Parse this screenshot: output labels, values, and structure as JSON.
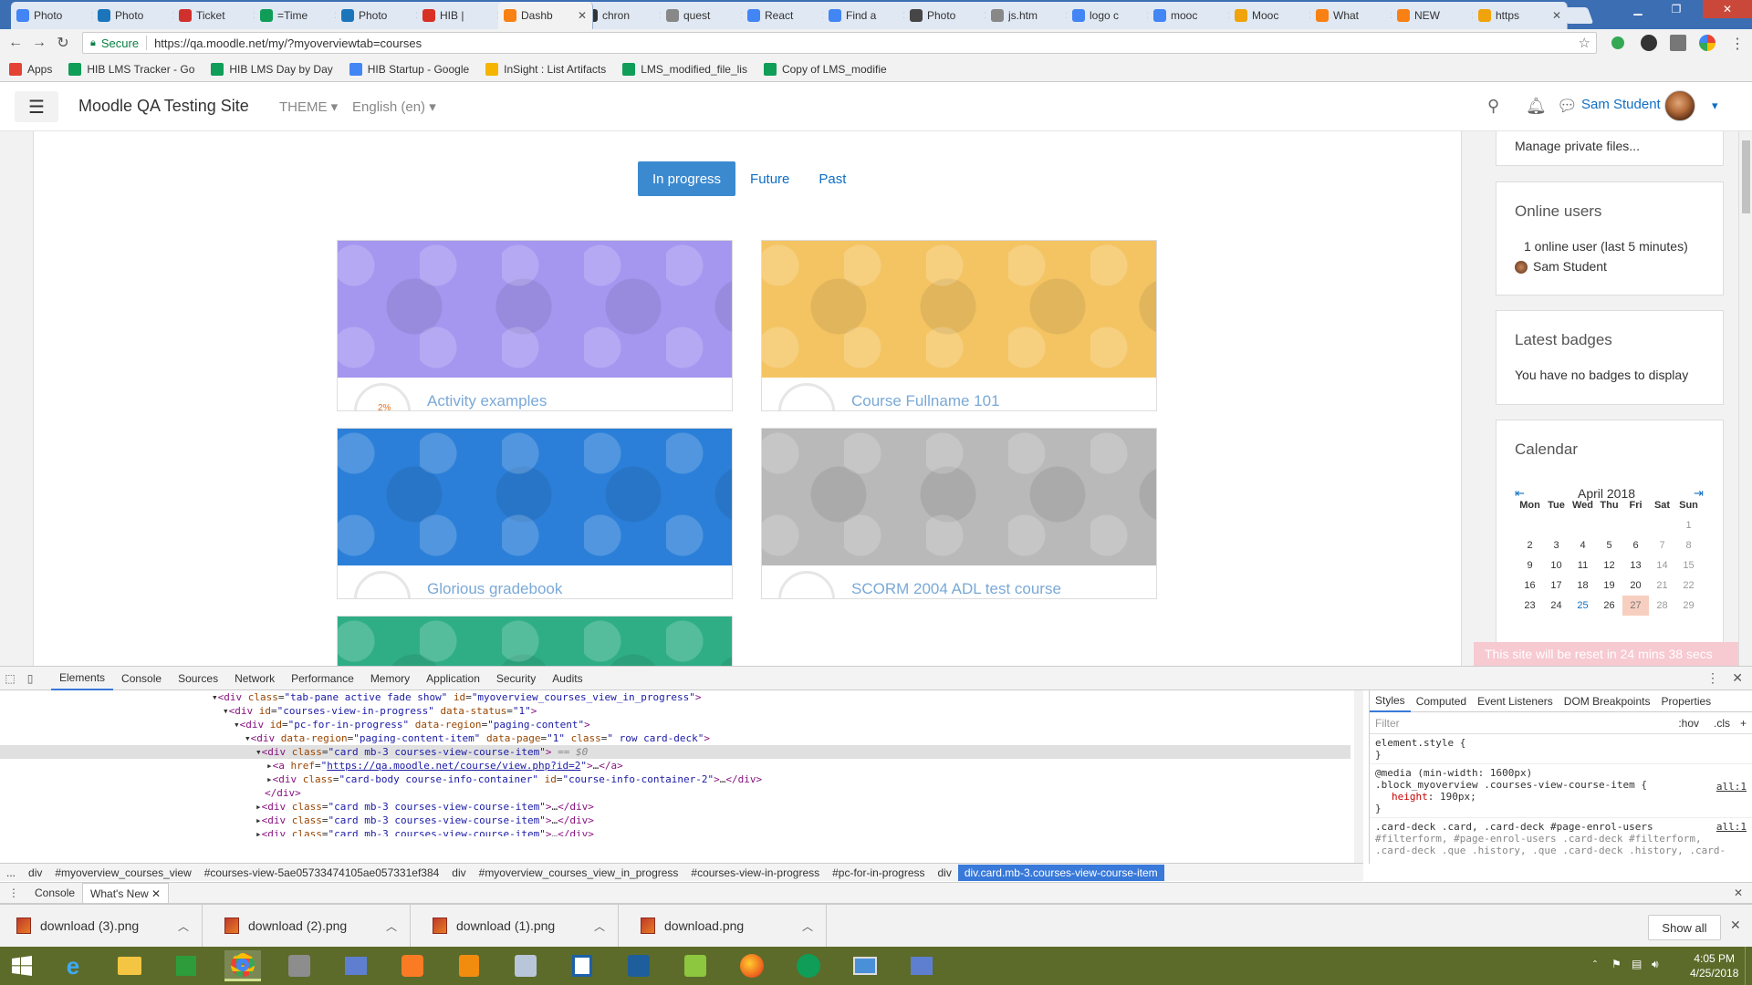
{
  "browser": {
    "tabs": [
      {
        "title": "Photo",
        "fav": "#4285f4",
        "fav_icon": "chrome-photos-icon"
      },
      {
        "title": "Photo",
        "fav": "#1b75bb",
        "fav_icon": "diamond-icon"
      },
      {
        "title": "Ticket",
        "fav": "#d0312d",
        "fav_icon": "ticket-icon"
      },
      {
        "title": "=Time",
        "fav": "#0f9d58",
        "fav_icon": "sheets-icon"
      },
      {
        "title": "Photo",
        "fav": "#1b75bb",
        "fav_icon": "diamond-icon"
      },
      {
        "title": "HIB |",
        "fav": "#d93025",
        "fav_icon": "gmail-icon"
      },
      {
        "title": "Dashb",
        "fav": "#f98012",
        "fav_icon": "moodle-icon"
      },
      {
        "title": "chron",
        "fav": "#333333",
        "fav_icon": "github-icon"
      },
      {
        "title": "quest",
        "fav": "#888888",
        "fav_icon": "doc-icon"
      },
      {
        "title": "React",
        "fav": "#4285f4",
        "fav_icon": "docs-icon"
      },
      {
        "title": "Find a",
        "fav": "#4285f4",
        "fav_icon": "google-icon"
      },
      {
        "title": "Photo",
        "fav": "#464646",
        "fav_icon": "wordpress-icon"
      },
      {
        "title": "js.htm",
        "fav": "#888888",
        "fav_icon": "doc-icon"
      },
      {
        "title": "logo c",
        "fav": "#4285f4",
        "fav_icon": "google-icon"
      },
      {
        "title": "mooc",
        "fav": "#4285f4",
        "fav_icon": "google-icon"
      },
      {
        "title": "Mooc",
        "fav": "#f0a30a",
        "fav_icon": "chart-icon"
      },
      {
        "title": "What",
        "fav": "#f98012",
        "fav_icon": "moodle-icon"
      },
      {
        "title": "NEW",
        "fav": "#f98012",
        "fav_icon": "moodle-icon"
      },
      {
        "title": "https",
        "fav": "#f0a30a",
        "fav_icon": "chart-icon"
      }
    ],
    "secure_label": "Secure",
    "url": "https://qa.moodle.net/my/?myoverviewtab=courses",
    "bookmarks": [
      {
        "label": "Apps",
        "color": "#e34234"
      },
      {
        "label": "HIB LMS Tracker - Go",
        "color": "#0f9d58"
      },
      {
        "label": "HIB LMS Day by Day",
        "color": "#0f9d58"
      },
      {
        "label": "HIB Startup - Google",
        "color": "#4285f4"
      },
      {
        "label": "InSight : List Artifacts",
        "color": "#f5b400"
      },
      {
        "label": "LMS_modified_file_lis",
        "color": "#0f9d58"
      },
      {
        "label": "Copy of LMS_modifie",
        "color": "#0f9d58"
      }
    ]
  },
  "navbar": {
    "site_name": "Moodle QA Testing Site",
    "theme_label": "THEME",
    "language_label": "English (en)",
    "user_name": "Sam Student"
  },
  "overview": {
    "tabs": [
      "In progress",
      "Future",
      "Past"
    ],
    "courses": [
      {
        "title": "Activity examples",
        "color": "#a596f0",
        "progress_label": "2%"
      },
      {
        "title": "Course Fullname 101",
        "color": "#f4c463"
      },
      {
        "title": "Glorious gradebook",
        "color": "#2b7fd8"
      },
      {
        "title": "SCORM 2004 ADL test course",
        "color": "#b9b9b9"
      },
      {
        "title": "",
        "color": "#2fae86"
      }
    ]
  },
  "blocks": {
    "private_files_link": "Manage private files...",
    "online_users": {
      "title": "Online users",
      "summary": "1 online user (last 5 minutes)",
      "user": "Sam Student"
    },
    "badges": {
      "title": "Latest badges",
      "text": "You have no badges to display"
    },
    "calendar": {
      "title": "Calendar",
      "month": "April 2018",
      "days": [
        "Mon",
        "Tue",
        "Wed",
        "Thu",
        "Fri",
        "Sat",
        "Sun"
      ],
      "weeks": [
        [
          "",
          "",
          "",
          "",
          "",
          "",
          "1"
        ],
        [
          "2",
          "3",
          "4",
          "5",
          "6",
          "7",
          "8"
        ],
        [
          "9",
          "10",
          "11",
          "12",
          "13",
          "14",
          "15"
        ],
        [
          "16",
          "17",
          "18",
          "19",
          "20",
          "21",
          "22"
        ],
        [
          "23",
          "24",
          "25",
          "26",
          "27",
          "28",
          "29"
        ]
      ]
    },
    "reset_notice": "This site will be reset in 24 mins 38 secs"
  },
  "devtools": {
    "tabs": [
      "Elements",
      "Console",
      "Sources",
      "Network",
      "Performance",
      "Memory",
      "Application",
      "Security",
      "Audits"
    ],
    "style_tabs": [
      "Styles",
      "Computed",
      "Event Listeners",
      "DOM Breakpoints",
      "Properties"
    ],
    "filter_placeholder": "Filter",
    "hov": ":hov",
    "cls": ".cls",
    "rules": {
      "element_style": "element.style {",
      "close": "}",
      "media": "@media (min-width: 1600px)",
      "selector1": ".block_myoverview .courses-view-course-item {",
      "prop1": "height",
      "val1": "190px;",
      "src": "all:1",
      "selector2": ".card-deck .card, .card-deck #page-enrol-users",
      "selector2b": "#filterform, #page-enrol-users .card-deck #filterform,",
      "selector2c": ".card-deck .que .history, .que .card-deck .history, .card-"
    },
    "breadcrumbs": [
      "...",
      "div",
      "#myoverview_courses_view",
      "#courses-view-5ae05733474105ae057331ef384",
      "div",
      "#myoverview_courses_view_in_progress",
      "#courses-view-in-progress",
      "#pc-for-in-progress",
      "div",
      "div.card.mb-3.courses-view-course-item"
    ],
    "drawer_tabs": [
      "Console",
      "What's New"
    ]
  },
  "downloads": {
    "items": [
      "download (3).png",
      "download (2).png",
      "download (1).png",
      "download.png"
    ],
    "show_all": "Show all"
  },
  "taskbar": {
    "time": "4:05 PM",
    "date": "4/25/2018"
  }
}
